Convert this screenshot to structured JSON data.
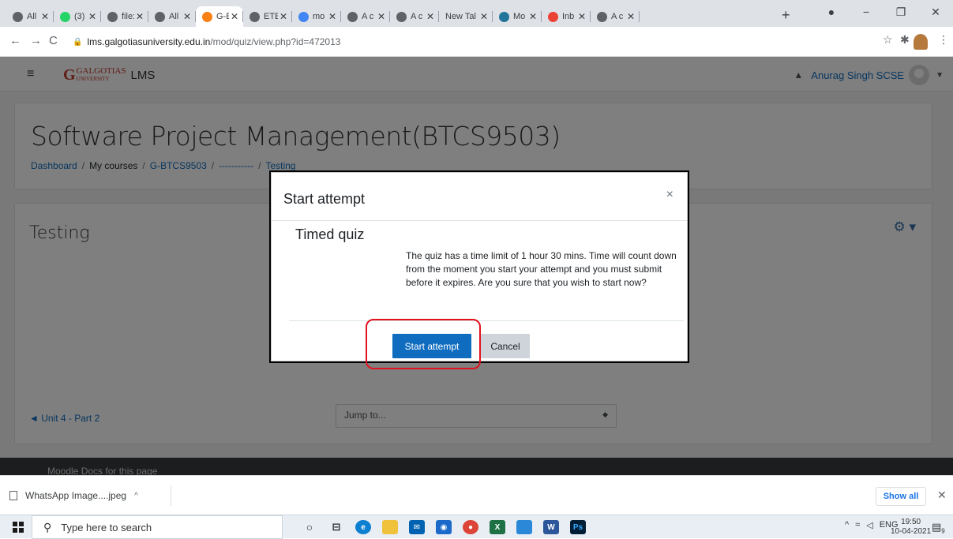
{
  "browser": {
    "tabs": [
      {
        "label": "All I",
        "icon": "globe-icon",
        "color": "#5f6368"
      },
      {
        "label": "(3) \\",
        "icon": "whatsapp-icon",
        "color": "#25d366"
      },
      {
        "label": "file:",
        "icon": "globe-icon",
        "color": "#5f6368"
      },
      {
        "label": "All I",
        "icon": "globe-icon",
        "color": "#5f6368"
      },
      {
        "label": "G-E",
        "icon": "moodle-icon",
        "color": "#f98012",
        "active": true
      },
      {
        "label": "ETE",
        "icon": "globe-icon",
        "color": "#5f6368"
      },
      {
        "label": "mo",
        "icon": "google-icon",
        "color": "#4285f4"
      },
      {
        "label": "A c",
        "icon": "globe-icon",
        "color": "#5f6368"
      },
      {
        "label": "A c",
        "icon": "globe-icon",
        "color": "#5f6368"
      },
      {
        "label": "New Tal",
        "icon": "",
        "color": ""
      },
      {
        "label": "Mo",
        "icon": "wordpress-icon",
        "color": "#21759b"
      },
      {
        "label": "Inb",
        "icon": "gmail-icon",
        "color": "#ea4335"
      },
      {
        "label": "A c",
        "icon": "globe-icon",
        "color": "#5f6368"
      }
    ],
    "new_tab": "+",
    "url_domain": "lms.galgotiasuniversity.edu.in",
    "url_path": "/mod/quiz/view.php?id=472013"
  },
  "site": {
    "logo_letter": "G",
    "logo_text_top": "GALGOTIAS",
    "logo_text_bottom": "UNIVERSITY",
    "name": "LMS",
    "user_name": "Anurag Singh SCSE"
  },
  "course": {
    "title": "Software Project Management(BTCS9503)",
    "breadcrumb": [
      "Dashboard",
      "My courses",
      "G-BTCS9503",
      "-----------",
      "Testing"
    ],
    "section_title": "Testing",
    "prev_link": "◄ Unit 4 - Part 2",
    "jump_placeholder": "Jump to...",
    "footer_text": "Moodle Docs for this page"
  },
  "modal": {
    "title": "Start attempt",
    "close": "×",
    "heading": "Timed quiz",
    "message": "The quiz has a time limit of 1 hour 30 mins. Time will count down from the moment you start your attempt and you must submit before it expires. Are you sure that you wish to start now?",
    "start_label": "Start attempt",
    "cancel_label": "Cancel"
  },
  "downloads": {
    "file": "WhatsApp Image....jpeg",
    "show_all": "Show all"
  },
  "taskbar": {
    "search_placeholder": "Type here to search",
    "lang": "ENG",
    "time": "19:50",
    "date": "10-04-2021",
    "notifications": "9"
  }
}
